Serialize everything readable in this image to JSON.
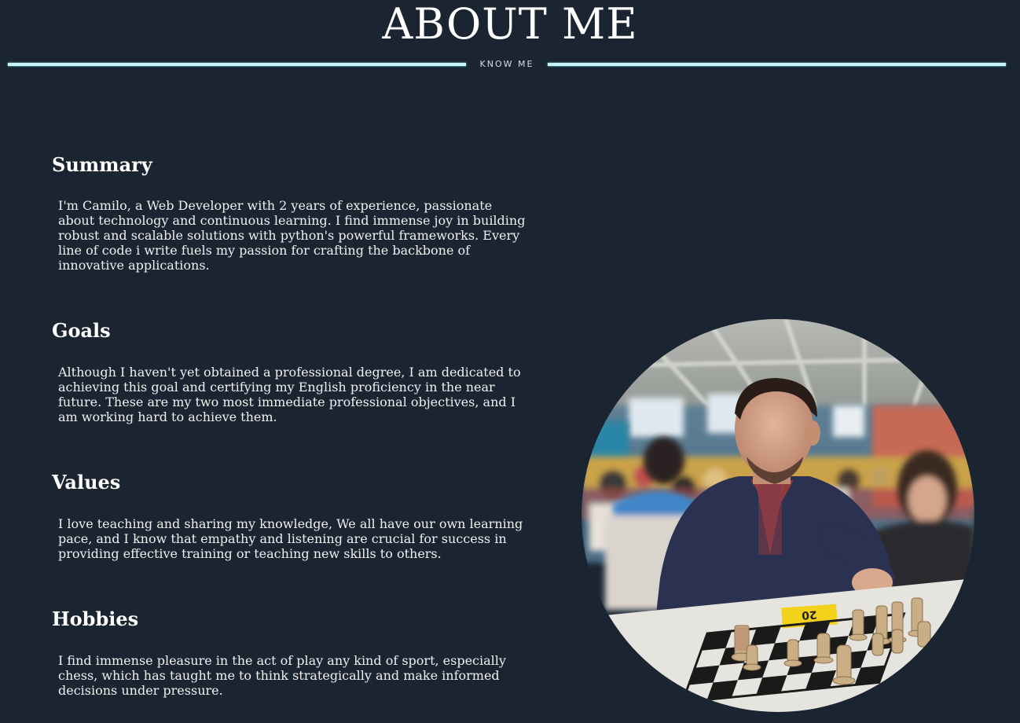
{
  "header": {
    "title": "ABOUT ME",
    "subtitle": "KNOW ME"
  },
  "sections": [
    {
      "title": "Summary",
      "body": "I'm Camilo, a Web Developer with 2 years of experience, passionate about technology and continuous learning. I find immense joy in building robust and scalable solutions with python's powerful frameworks. Every line of code i write fuels my passion for crafting the backbone of innovative applications."
    },
    {
      "title": "Goals",
      "body": "Although I haven't yet obtained a professional degree, I am dedicated to achieving this goal and certifying my English proficiency in the near future. These are my two most immediate professional objectives, and I am working hard to achieve them."
    },
    {
      "title": "Values",
      "body": "I love teaching and sharing my knowledge, We all have our own learning pace, and I know that empathy and listening are crucial for success in providing effective training or teaching new skills to others."
    },
    {
      "title": "Hobbies",
      "body": "I find immense pleasure in the act of play any kind of sport, especially chess, which has taught me to think strategically and make informed decisions under pressure."
    }
  ],
  "photo": {
    "icon": "profile-photo-chess"
  },
  "colors": {
    "background": "#1b2532",
    "accent_line": "#c8f6f8",
    "text": "#ffffff"
  }
}
